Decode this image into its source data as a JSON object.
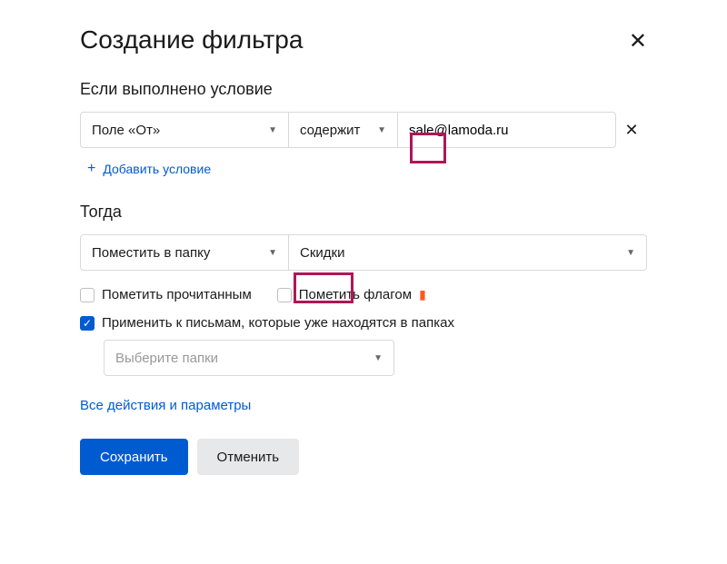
{
  "dialog": {
    "title": "Создание фильтра",
    "close": "✕"
  },
  "condition": {
    "heading": "Если выполнено условие",
    "field": "Поле «От»",
    "operator": "содержит",
    "value": "sale@lamoda.ru",
    "remove": "✕",
    "add_label": "Добавить условие",
    "plus": "+"
  },
  "then": {
    "heading": "Тогда",
    "action": "Поместить в папку",
    "folder": "Скидки",
    "mark_read": "Пометить прочитанным",
    "mark_flag": "Пометить флагом",
    "apply_existing": "Применить к письмам, которые уже находятся в папках",
    "select_folders_placeholder": "Выберите папки"
  },
  "links": {
    "all_params": "Все действия и параметры"
  },
  "buttons": {
    "save": "Сохранить",
    "cancel": "Отменить"
  }
}
